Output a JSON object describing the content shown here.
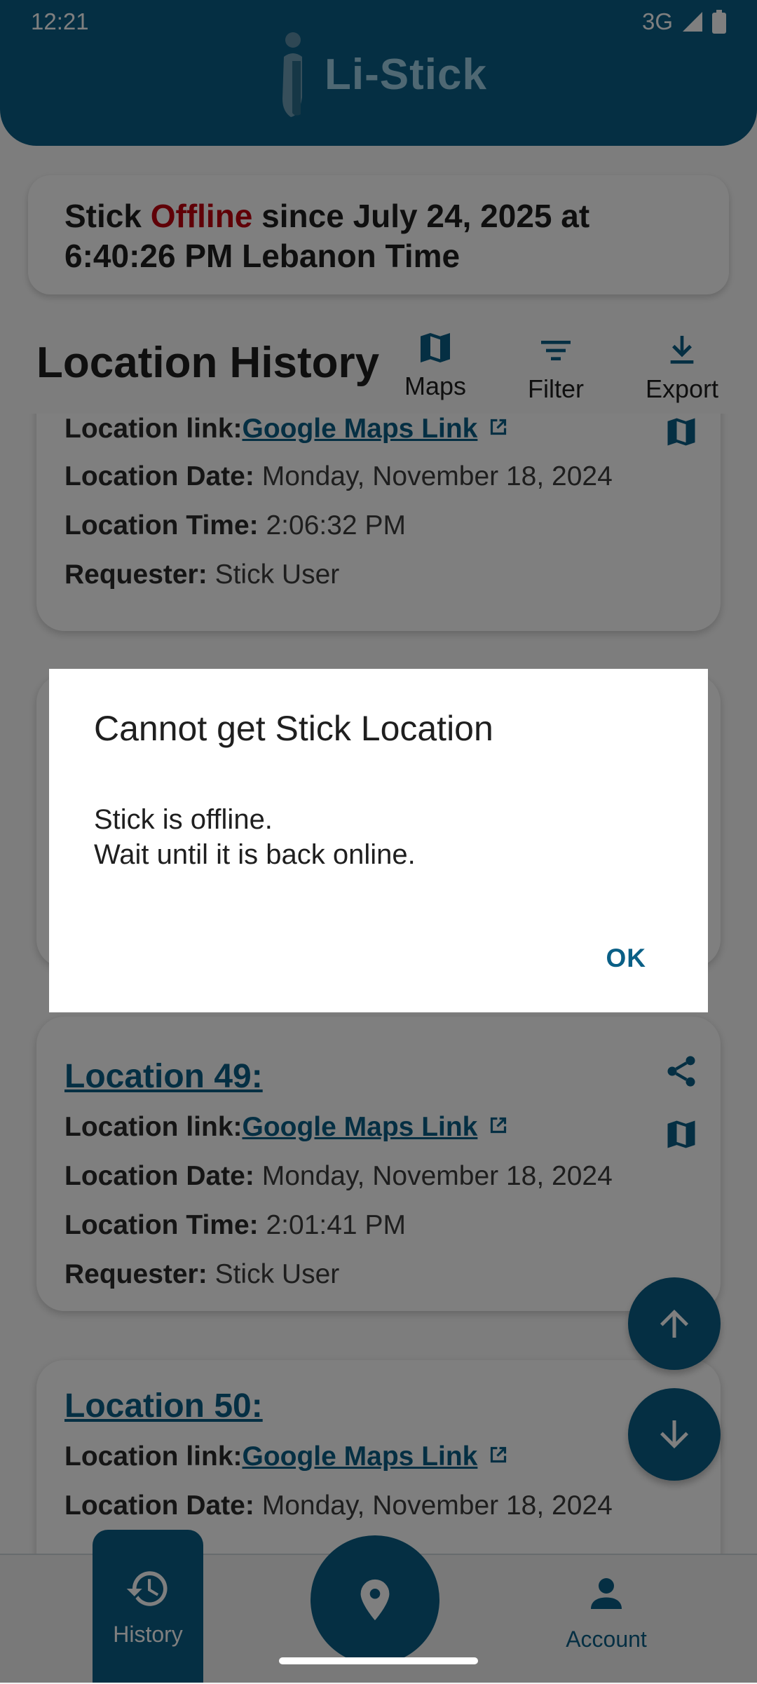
{
  "status_bar": {
    "time": "12:21",
    "network": "3G"
  },
  "app": {
    "title": "Li-Stick"
  },
  "offline_banner": {
    "prefix": "Stick ",
    "status_word": "Offline",
    "line1_rest": " since July 24, 2025 at",
    "line2": "6:40:26 PM Lebanon Time"
  },
  "history": {
    "title": "Location History",
    "tools": {
      "maps": "Maps",
      "filter": "Filter",
      "export": "Export"
    }
  },
  "cards": [
    {
      "link_label": "Location link:",
      "link_text": "Google Maps Link",
      "date_label": "Location Date:",
      "date_value": "Monday, November 18, 2024",
      "time_label": "Location Time:",
      "time_value": "2:06:32 PM",
      "requester_label": "Requester:",
      "requester_value": "Stick User"
    },
    {
      "title": "Location 49:",
      "link_label": "Location link:",
      "link_text": "Google Maps Link",
      "date_label": "Location Date:",
      "date_value": "Monday, November 18, 2024",
      "time_label": "Location Time:",
      "time_value": "2:01:41 PM",
      "requester_label": "Requester:",
      "requester_value": "Stick User"
    },
    {
      "title": "Location 50:",
      "link_label": "Location link:",
      "link_text": "Google Maps Link",
      "date_label": "Location Date:",
      "date_value": "Monday, November 18, 2024"
    }
  ],
  "bottom_nav": {
    "history": "History",
    "account": "Account"
  },
  "dialog": {
    "title": "Cannot get Stick Location",
    "message": "Stick is offline.\nWait until it is back online.",
    "ok": "OK"
  }
}
